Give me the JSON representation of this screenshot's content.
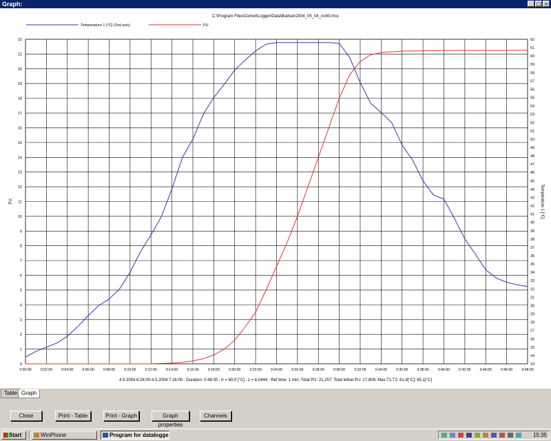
{
  "window": {
    "title": "Graph:",
    "min_label": "_",
    "max_label": "□",
    "close_label": "×"
  },
  "graph": {
    "file_path": "C:\\Program Files\\Comet\\Logger\\Data\\Budvar\\2004_05_04_no00.mss",
    "footer": "4.5.2004 6:28:00-4.5.2004 7:16:00 ; Duration: 0:48:00 ; tr = 60,0 [°C] ; z = 6,0444 ; Ref time: 1 min; Total PU: 21,257; Total lethal PU: 17,806; Max.T1,T2: 61,8[°C]; 65,1[°C]"
  },
  "chart_data": {
    "type": "line",
    "xlabel": "",
    "ylabel": "PU",
    "y2label": "Temperature 1 [°C]",
    "ylim": [
      0,
      22
    ],
    "y2lim": [
      23,
      62
    ],
    "x_ticks": [
      "0:00:00",
      "0:02:00",
      "0:04:00",
      "0:06:00",
      "0:08:00",
      "0:10:00",
      "0:12:00",
      "0:14:00",
      "0:16:00",
      "0:18:00",
      "0:20:00",
      "0:22:00",
      "0:24:00",
      "0:26:00",
      "0:28:00",
      "0:30:00",
      "0:32:00",
      "0:34:00",
      "0:36:00",
      "0:38:00",
      "0:40:00",
      "0:42:00",
      "0:44:00",
      "0:46:00",
      "0:48:00"
    ],
    "grid": true,
    "legend_position": "top-left",
    "series": [
      {
        "name": "Temperature 1 [°C] (2nd axis)",
        "axis": "right",
        "color": "#3333aa",
        "x": [
          0,
          1,
          2,
          3,
          4,
          5,
          6,
          7,
          8,
          9,
          10,
          11,
          12,
          13,
          14,
          15,
          16,
          17,
          18,
          19,
          20,
          21,
          22,
          23,
          24,
          25,
          26,
          27,
          28,
          29,
          30,
          31,
          32,
          33,
          34,
          35,
          36,
          37,
          38,
          39,
          40,
          41,
          42,
          43,
          44,
          45,
          46,
          47,
          48
        ],
        "y": [
          23.8,
          24.5,
          25.0,
          25.5,
          26.3,
          27.5,
          28.8,
          30.0,
          30.8,
          32.0,
          34.0,
          36.5,
          38.5,
          40.7,
          44.0,
          47.8,
          50.0,
          53.0,
          55.0,
          56.6,
          58.3,
          59.5,
          60.6,
          61.4,
          61.6,
          61.6,
          61.6,
          61.6,
          61.6,
          61.6,
          61.5,
          59.8,
          56.8,
          54.3,
          53.2,
          52.0,
          49.3,
          47.5,
          45.0,
          43.3,
          42.8,
          40.5,
          38.0,
          36.2,
          34.3,
          33.3,
          32.8,
          32.5,
          32.3
        ]
      },
      {
        "name": "PU",
        "axis": "left",
        "color": "#dd3333",
        "x": [
          0,
          2,
          4,
          6,
          8,
          10,
          12,
          14,
          15,
          16,
          17,
          18,
          19,
          20,
          21,
          22,
          23,
          24,
          25,
          26,
          27,
          28,
          29,
          30,
          31,
          32,
          33,
          34,
          36,
          38,
          40,
          42,
          44,
          46,
          48
        ],
        "y": [
          0,
          0,
          0,
          0,
          0,
          0,
          0,
          0.05,
          0.1,
          0.2,
          0.35,
          0.6,
          1.0,
          1.6,
          2.5,
          3.5,
          5.0,
          6.6,
          8.2,
          10.0,
          12.0,
          14.0,
          16.0,
          18.0,
          19.6,
          20.5,
          20.95,
          21.1,
          21.2,
          21.22,
          21.24,
          21.25,
          21.25,
          21.25,
          21.26
        ]
      }
    ]
  },
  "tabs": [
    {
      "label": "Table"
    },
    {
      "label": "Graph"
    }
  ],
  "buttons": {
    "close": "Close",
    "print_table": "Print - Table",
    "print_graph": "Print - Graph",
    "properties": "Graph properties",
    "channels": "Channels"
  },
  "taskbar": {
    "start": "Start",
    "task1": "WinPhone",
    "task2": "Program for dataloggers",
    "clock": "15:35"
  }
}
